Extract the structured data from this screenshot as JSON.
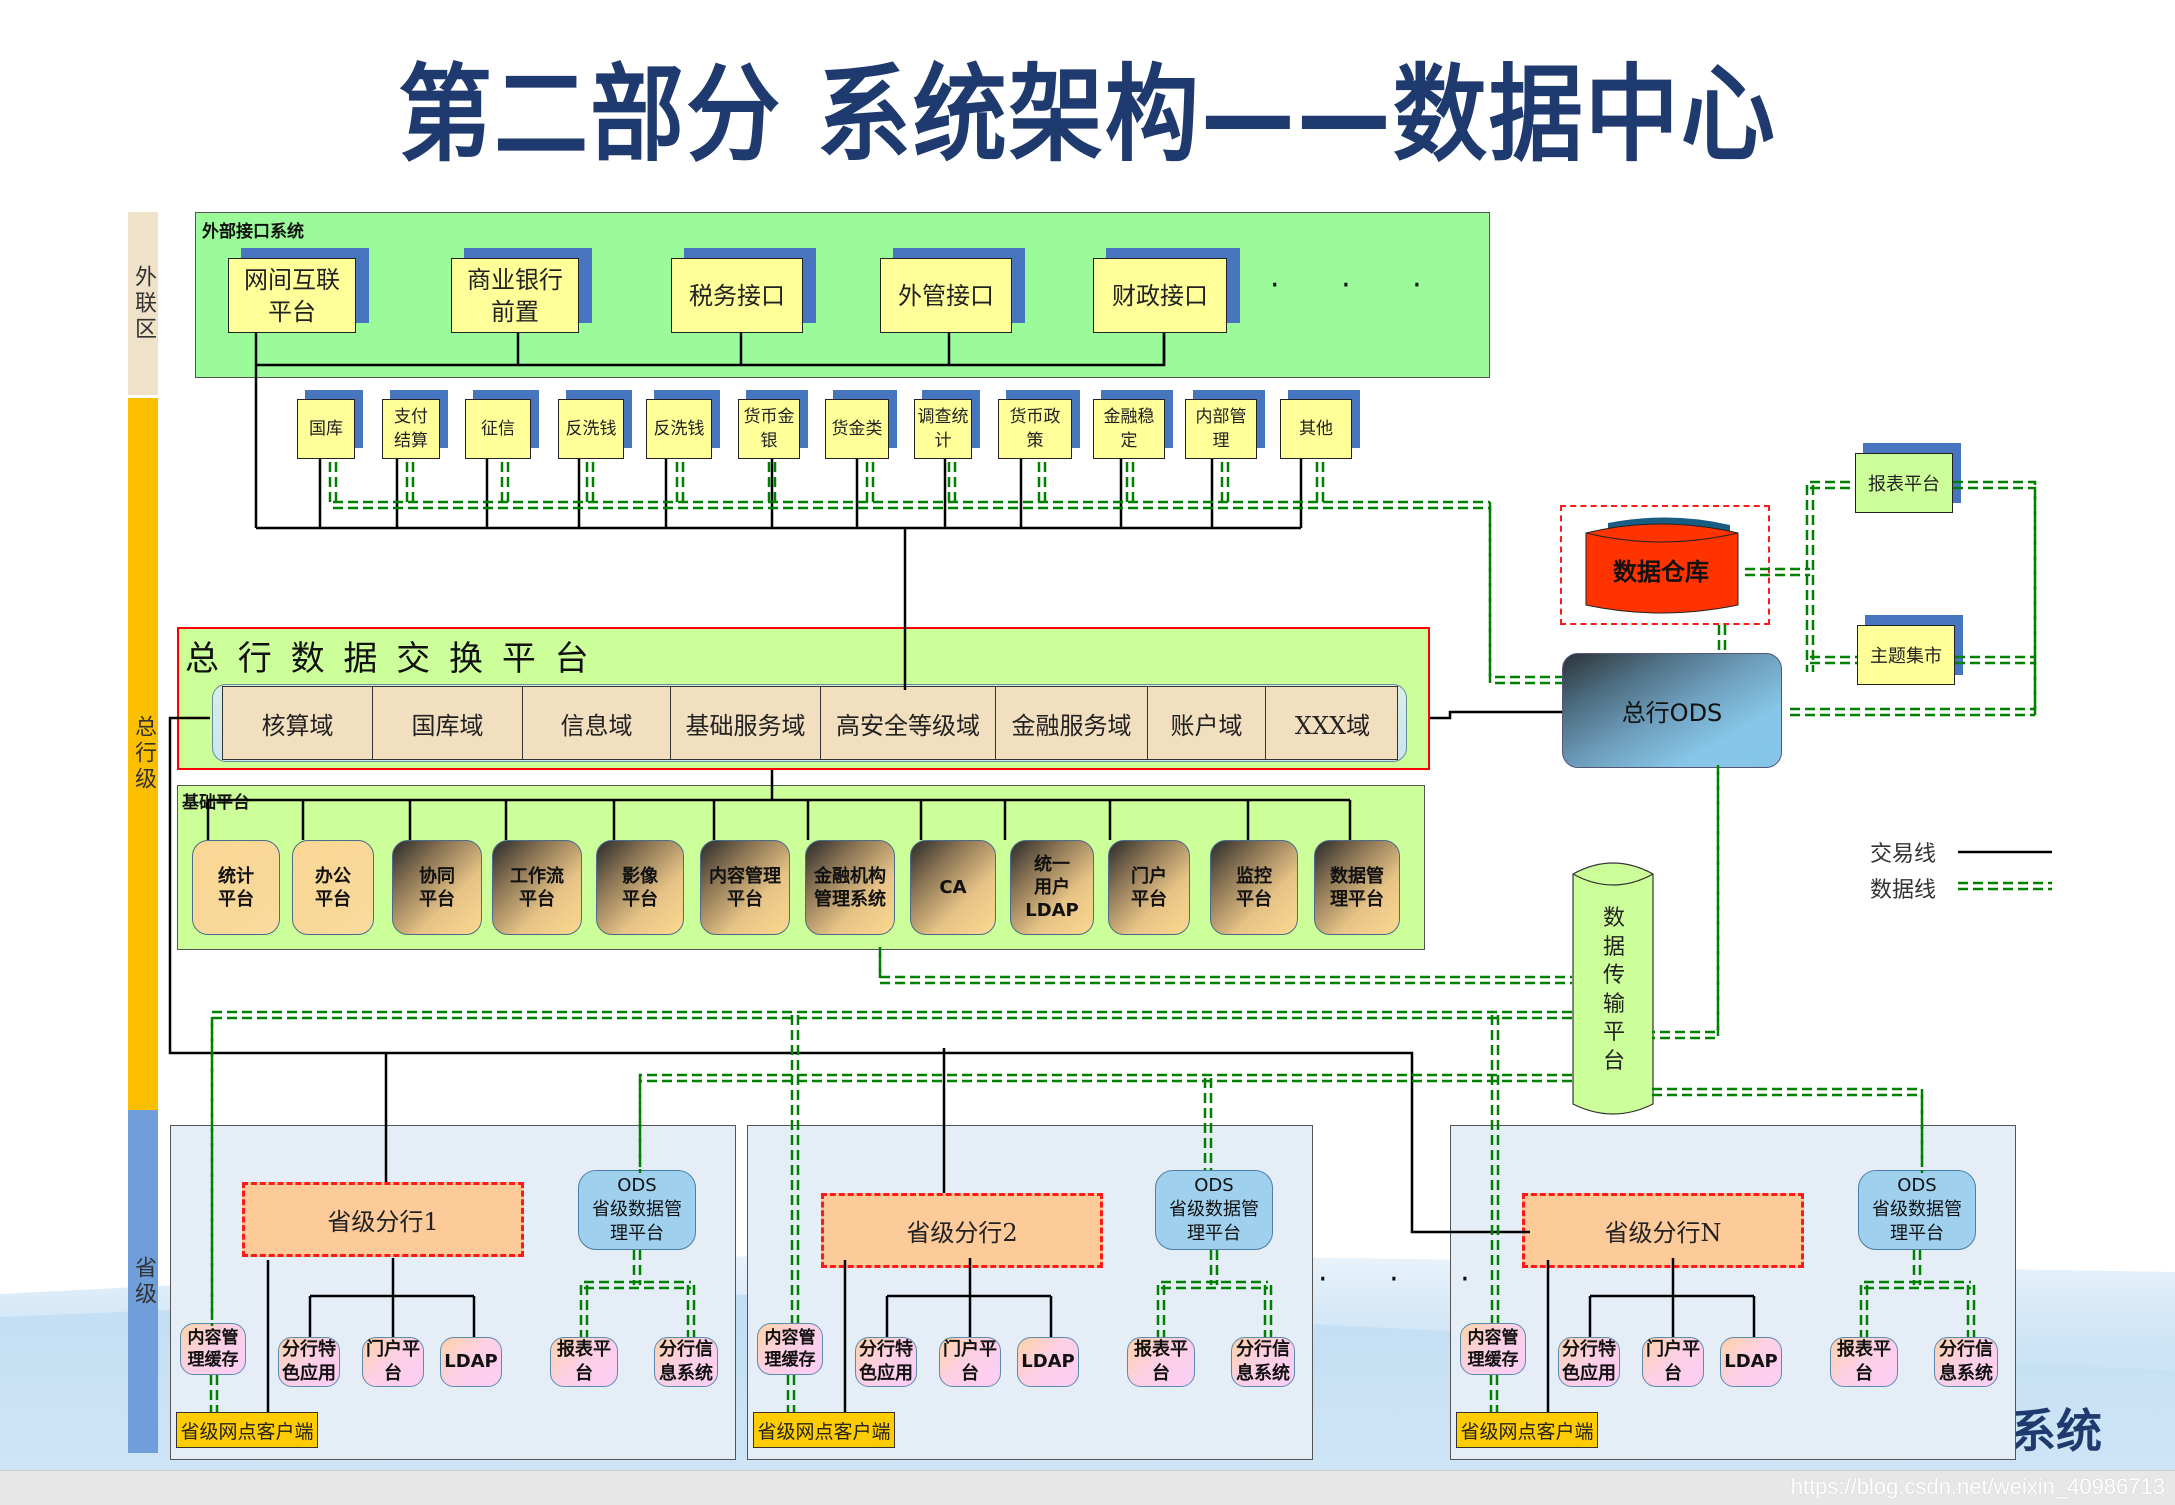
{
  "title": "第二部分 系统架构——数据中心",
  "brand_fragment": "系统",
  "watermark": "https://blog.csdn.net/weixin_40986713",
  "colors": {
    "title": "#1f3a6e",
    "trade_line": "#000000",
    "data_line": "#008000",
    "band_external": "#efe2c8",
    "band_head": "#fcbf00",
    "band_province": "#6f9edb"
  },
  "bands": [
    {
      "label": "外联区"
    },
    {
      "label": "总行级"
    },
    {
      "label": "省级"
    }
  ],
  "external": {
    "title": "外部接口系统",
    "systems": [
      {
        "label": "网间互联\n平台"
      },
      {
        "label": "商业银行\n前置"
      },
      {
        "label": "税务接口"
      },
      {
        "label": "外管接口"
      },
      {
        "label": "财政接口"
      }
    ],
    "more": "· · ·"
  },
  "business_systems": [
    {
      "label": "国库"
    },
    {
      "label": "支付\n结算"
    },
    {
      "label": "征信"
    },
    {
      "label": "反洗钱"
    },
    {
      "label": "反洗钱"
    },
    {
      "label": "货币金\n银"
    },
    {
      "label": "货金类"
    },
    {
      "label": "调查统\n计"
    },
    {
      "label": "货币政\n策"
    },
    {
      "label": "金融稳\n定"
    },
    {
      "label": "内部管\n理"
    },
    {
      "label": "其他"
    }
  ],
  "exchange": {
    "title": "总 行 数 据 交 换 平 台",
    "domains": [
      "核算域",
      "国库域",
      "信息域",
      "基础服务域",
      "高安全等级域",
      "金融服务域",
      "账户域",
      "XXX域"
    ]
  },
  "base_platform": {
    "title": "基础平台",
    "items": [
      {
        "label": "统计\n平台",
        "style": "light"
      },
      {
        "label": "办公\n平台",
        "style": "light"
      },
      {
        "label": "协同\n平台",
        "style": "dark"
      },
      {
        "label": "工作流\n平台",
        "style": "dark"
      },
      {
        "label": "影像\n平台",
        "style": "dark"
      },
      {
        "label": "内容管理\n平台",
        "style": "dark"
      },
      {
        "label": "金融机构\n管理系统",
        "style": "dark"
      },
      {
        "label": "CA",
        "style": "dark"
      },
      {
        "label": "统一\n用户\nLDAP",
        "style": "dark"
      },
      {
        "label": "门户\n平台",
        "style": "dark"
      },
      {
        "label": "监控\n平台",
        "style": "dark"
      },
      {
        "label": "数据管\n理平台",
        "style": "dark"
      }
    ]
  },
  "data_center": {
    "warehouse": "数据仓库",
    "ods": "总行ODS",
    "report": "报表平台",
    "mart": "主题集市",
    "transfer": "数据传输平台"
  },
  "legend": {
    "trade": "交易线",
    "data": "数据线"
  },
  "provinces": [
    {
      "name": "省级分行1",
      "ods": "ODS\n省级数据管\n理平台",
      "cache": "内容管\n理缓存",
      "apps": [
        "分行特\n色应用",
        "门户平\n台",
        "LDAP"
      ],
      "data_apps": [
        "报表平\n台",
        "分行信\n息系统"
      ],
      "client": "省级网点客户端"
    },
    {
      "name": "省级分行2",
      "ods": "ODS\n省级数据管\n理平台",
      "cache": "内容管\n理缓存",
      "apps": [
        "分行特\n色应用",
        "门户平\n台",
        "LDAP"
      ],
      "data_apps": [
        "报表平\n台",
        "分行信\n息系统"
      ],
      "client": "省级网点客户端"
    },
    {
      "name": "省级分行N",
      "ods": "ODS\n省级数据管\n理平台",
      "cache": "内容管\n理缓存",
      "apps": [
        "分行特\n色应用",
        "门户平\n台",
        "LDAP"
      ],
      "data_apps": [
        "报表平\n台",
        "分行信\n息系统"
      ],
      "client": "省级网点客户端"
    }
  ],
  "province_more": "· · ·"
}
